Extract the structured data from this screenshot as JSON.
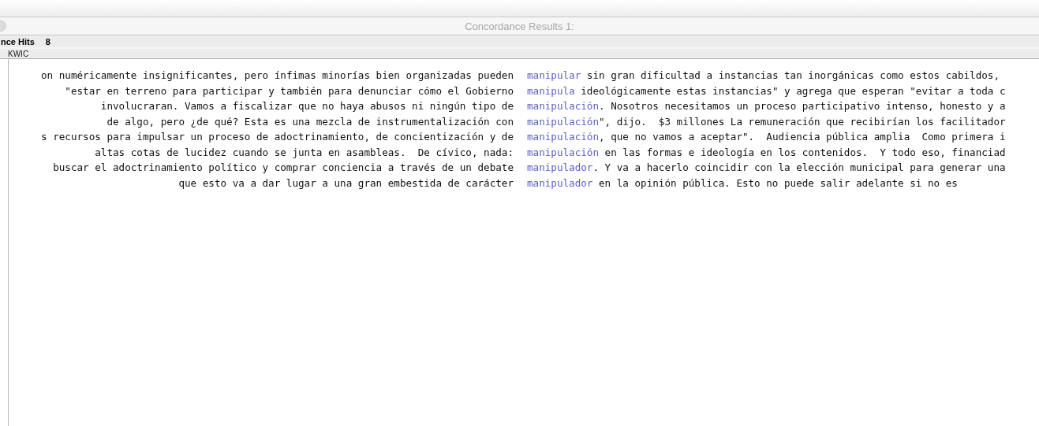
{
  "window": {
    "title": "Concordance Results 1:"
  },
  "summary": {
    "label": "nce Hits",
    "count": "8"
  },
  "tabs": [
    {
      "label": "KWIC",
      "selected": true
    }
  ],
  "rows": [
    {
      "left": "on numéricamente insignificantes, pero ínfimas minorías bien organizadas pueden",
      "hit": "manipular",
      "right": " sin gran dificultad a instancias tan inorgánicas como estos cabildos,"
    },
    {
      "left": "\"estar en terreno para participar y también para denunciar cómo el Gobierno",
      "hit": "manipula",
      "right": " ideológicamente estas instancias\" y agrega que esperan \"evitar a toda c"
    },
    {
      "left": "involucraran. Vamos a fiscalizar que no haya abusos ni ningún tipo de",
      "hit": "manipulación",
      "right": ". Nosotros necesitamos un proceso participativo intenso, honesto y a"
    },
    {
      "left": "de algo, pero ¿de qué? Esta es una mezcla de instrumentalización con",
      "hit": "manipulación",
      "right": "\", dijo.  $3 millones La remuneración que recibirían los facilitador"
    },
    {
      "left": "s recursos para impulsar un proceso de adoctrinamiento, de concientización y de",
      "hit": "manipulación",
      "right": ", que no vamos a aceptar\".  Audiencia pública amplia  Como primera i"
    },
    {
      "left": "altas cotas de lucidez cuando se junta en asambleas.  De cívico, nada:",
      "hit": "manipulación",
      "right": " en las formas e ideología en los contenidos.  Y todo eso, financiad"
    },
    {
      "left": "buscar el adoctrinamiento político y comprar conciencia a través de un debate",
      "hit": "manipulador",
      "right": ". Y va a hacerlo coincidir con la elección municipal para generar una"
    },
    {
      "left": "que esto va a dar lugar a una gran embestida de carácter",
      "hit": "manipulador",
      "right": " en la opinión pública. Esto no puede salir adelante si no es"
    }
  ]
}
